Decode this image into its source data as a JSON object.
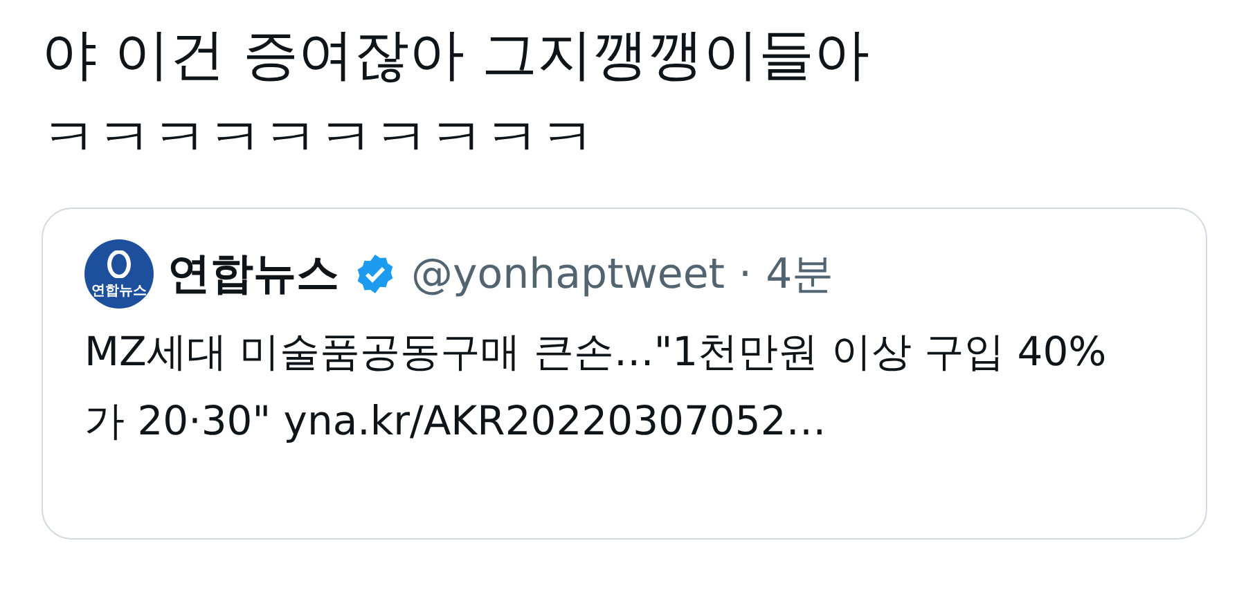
{
  "tweet": {
    "text_lines": [
      "야 이건 증여잖아 그지깽깽이들아",
      "ㅋㅋㅋㅋㅋㅋㅋㅋㅋㅋ"
    ]
  },
  "quoted_tweet": {
    "avatar_label": "연합뉴스",
    "name": "연합뉴스",
    "verified": true,
    "handle": "@yonhaptweet",
    "separator": "·",
    "time": "4분",
    "text": "MZ세대 미술품공동구매 큰손…\"1천만원 이상 구입 40%가 20·30\" yna.kr/AKR20220307052…"
  }
}
